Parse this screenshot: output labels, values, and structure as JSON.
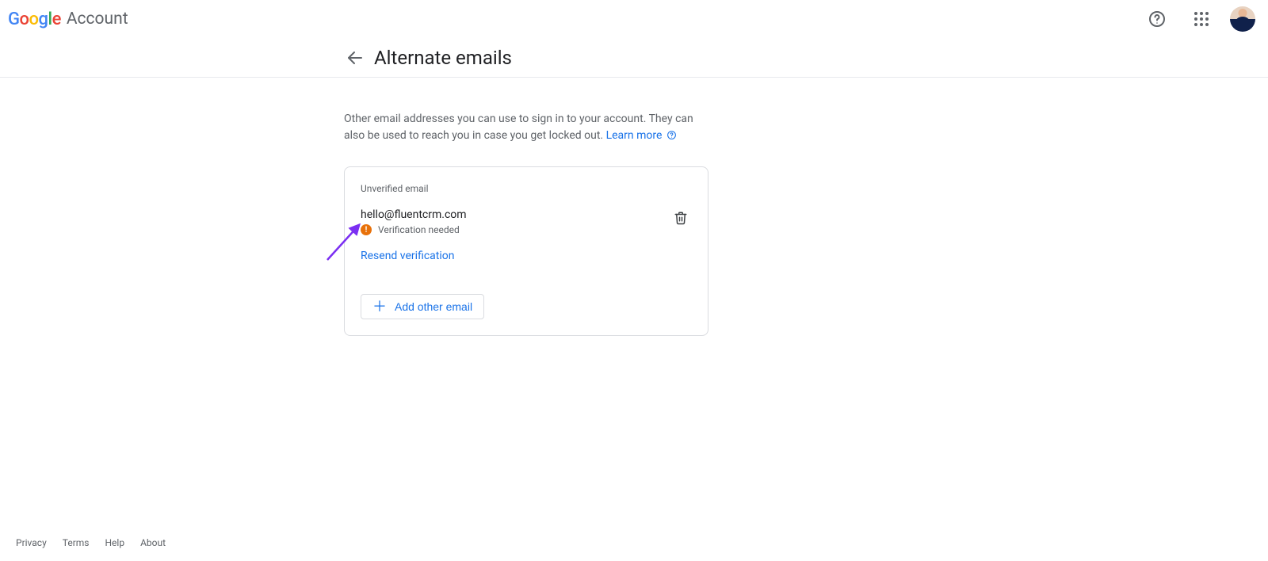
{
  "header": {
    "logo_brand": "Google",
    "logo_product": "Account"
  },
  "page": {
    "title": "Alternate emails",
    "intro": "Other email addresses you can use to sign in to your account. They can also be used to reach you in case you get locked out. ",
    "learn_more": "Learn more"
  },
  "card": {
    "section_label": "Unverified email",
    "email": "hello@fluentcrm.com",
    "status": "Verification needed",
    "resend": "Resend verification",
    "add_button": "Add other email"
  },
  "footer": {
    "privacy": "Privacy",
    "terms": "Terms",
    "help": "Help",
    "about": "About"
  }
}
